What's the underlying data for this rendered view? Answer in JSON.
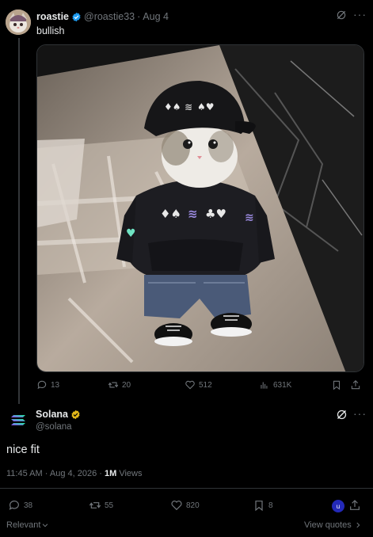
{
  "colors": {
    "background": "#000000",
    "text": "#e7e9ea",
    "muted": "#71767b",
    "verified_blue": "#1d9bf0",
    "verified_gold": "#e2b719",
    "badge_blue": "#2329b8"
  },
  "quoted_post": {
    "display_name": "roastie",
    "handle": "@roastie33",
    "separator": "·",
    "date": "Aug 4",
    "text": "bullish",
    "verified_icon": "verified-blue-icon",
    "media_description_icon": "cat-in-hoodie-image",
    "actions": {
      "replies": "13",
      "reposts": "20",
      "likes": "512",
      "views": "631K"
    }
  },
  "main_post": {
    "display_name": "Solana",
    "handle": "@solana",
    "verified_icon": "verified-gold-icon",
    "text": "nice fit",
    "time": "11:45 AM",
    "dot": "·",
    "date": "Aug 4, 2026",
    "views_count": "1M",
    "views_label": "Views",
    "actions": {
      "replies": "38",
      "reposts": "55",
      "likes": "820",
      "bookmarks": "8",
      "user_badge": "u"
    }
  },
  "footer": {
    "sort_label": "Relevant",
    "view_quotes_label": "View quotes"
  }
}
